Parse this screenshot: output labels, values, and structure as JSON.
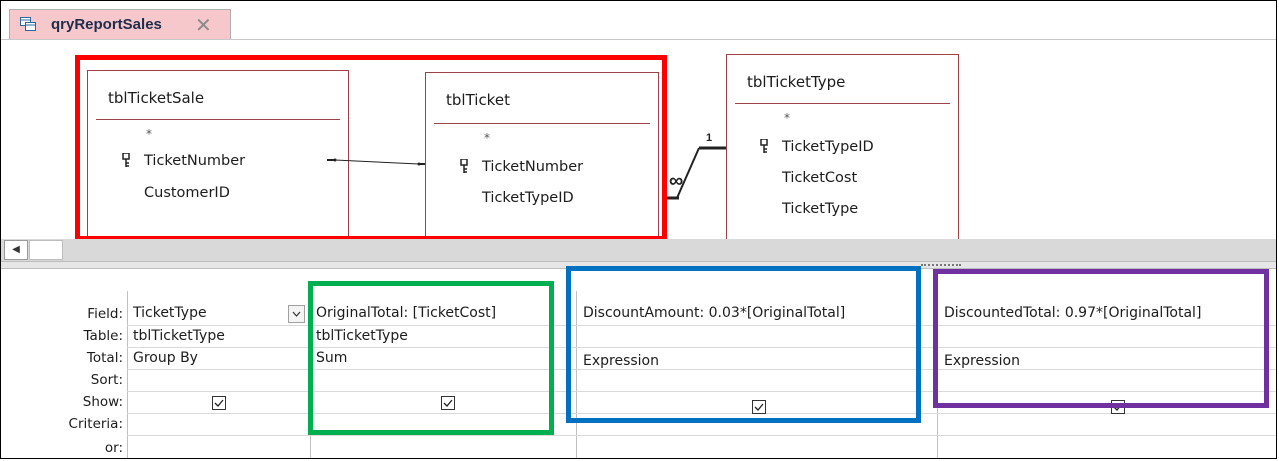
{
  "tab": {
    "title": "qryReportSales",
    "icon": "query-icon",
    "close_icon": "close-icon",
    "close_glyph": "✕"
  },
  "tables": {
    "sale": {
      "name": "tblTicketSale",
      "star": "*",
      "fields": [
        "TicketNumber",
        "CustomerID"
      ]
    },
    "ticket": {
      "name": "tblTicket",
      "star": "*",
      "fields": [
        "TicketNumber",
        "TicketTypeID"
      ]
    },
    "type": {
      "name": "tblTicketType",
      "star": "*",
      "fields": [
        "TicketTypeID",
        "TicketCost",
        "TicketType"
      ]
    }
  },
  "relationship": {
    "one_label": "1",
    "many_label": "∞"
  },
  "grid": {
    "row_labels": [
      "Field:",
      "Table:",
      "Total:",
      "Sort:",
      "Show:",
      "Criteria:",
      "or:"
    ],
    "columns": [
      {
        "field": "TicketType",
        "table": "tblTicketType",
        "total": "Group By",
        "sort": "",
        "show": true
      },
      {
        "field": "OriginalTotal: [TicketCost]",
        "table": "tblTicketType",
        "total": "Sum",
        "sort": "",
        "show": true
      },
      {
        "field": "DiscountAmount: 0.03*[OriginalTotal]",
        "table": "",
        "total": "Expression",
        "sort": "",
        "show": true
      },
      {
        "field": "DiscountedTotal: 0.97*[OriginalTotal]",
        "table": "",
        "total": "Expression",
        "sort": "",
        "show": true
      }
    ]
  },
  "annotation_colors": {
    "red": "#ff0000",
    "green": "#00b050",
    "blue": "#0070c0",
    "purple": "#7030a0"
  },
  "accent_colors": {
    "tab": "#f6c8cc",
    "table_border": "#a04048"
  }
}
